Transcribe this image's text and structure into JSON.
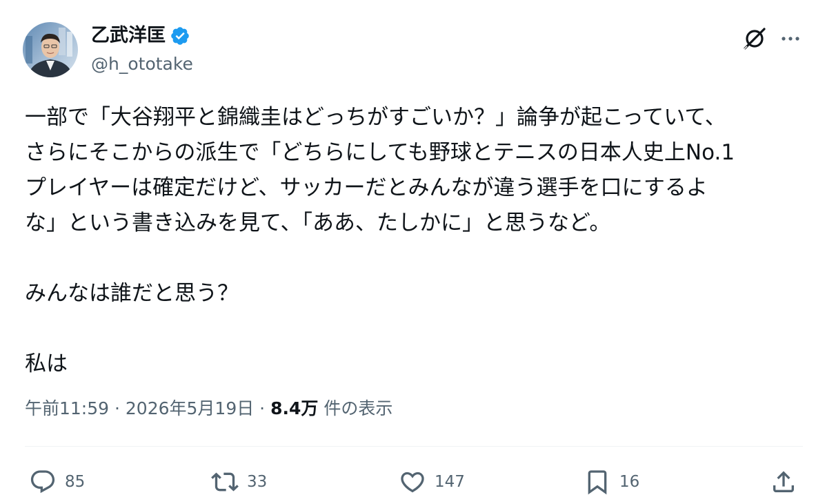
{
  "author": {
    "display_name": "乙武洋匡",
    "handle": "@h_ototake",
    "verified": true
  },
  "tweet": {
    "lines": [
      "一部で「大谷翔平と錦織圭はどっちがすごいか？」論争が起こっていて、",
      "さらにそこからの派生で「どちらにしても野球とテニスの日本人史上No.1",
      "プレイヤーは確定だけど、サッカーだとみんなが違う選手を口にするよ",
      "な」という書き込みを見て、「ああ、たしかに」と思うなど。",
      "",
      "みんなは誰だと思う？",
      "",
      "私は"
    ]
  },
  "meta": {
    "time": "午前11:59",
    "separator": " · ",
    "date": "2026年5月19日",
    "views_count": "8.4万",
    "views_label": " 件の表示"
  },
  "actions": {
    "reply_count": "85",
    "repost_count": "33",
    "like_count": "147",
    "bookmark_count": "16"
  },
  "icons": {
    "header": [
      "grok-icon",
      "more-icon"
    ],
    "action_bar": [
      "reply-icon",
      "repost-icon",
      "like-icon",
      "bookmark-icon",
      "share-icon"
    ],
    "verified": "verified-badge-icon"
  },
  "colors": {
    "text_primary": "#0f1419",
    "text_secondary": "#536471",
    "verified_blue": "#1d9bf0",
    "divider": "#eff3f4"
  }
}
